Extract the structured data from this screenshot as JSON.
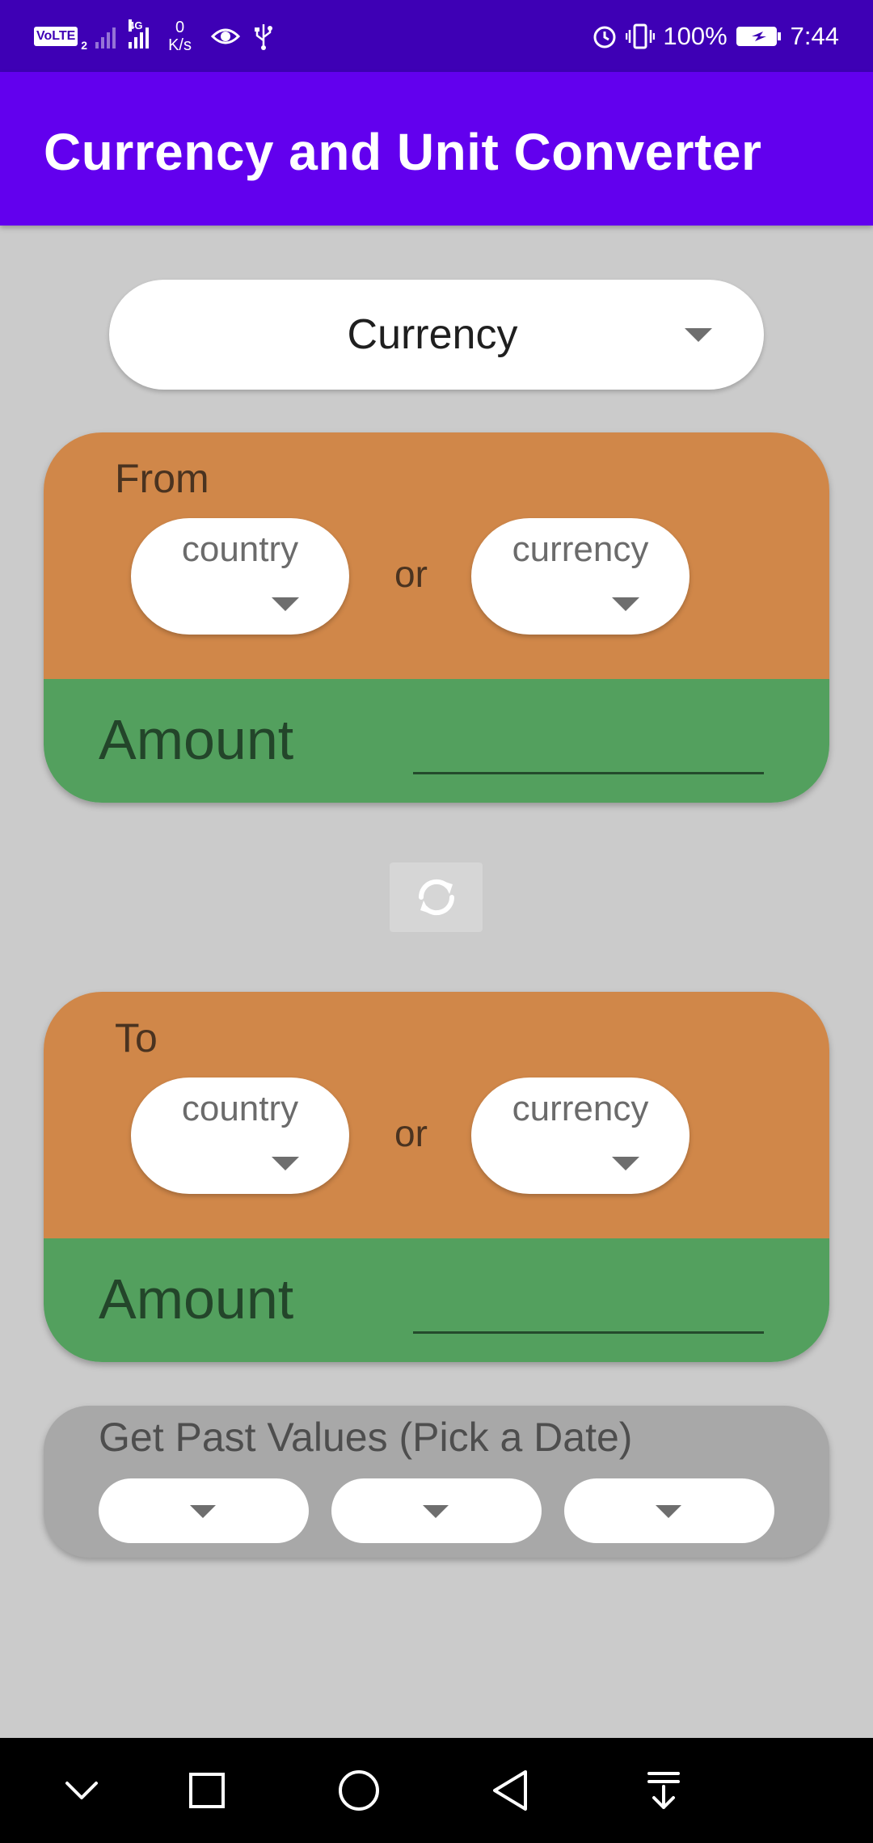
{
  "status_bar": {
    "volte": "VoLTE",
    "sim2": "2",
    "network": "4G",
    "speed_value": "0",
    "speed_unit": "K/s",
    "battery": "100%",
    "time": "7:44"
  },
  "app_bar": {
    "title": "Currency and Unit Converter"
  },
  "mode_spinner": {
    "value": "Currency"
  },
  "from_card": {
    "label": "From",
    "country_hint": "country",
    "or_text": "or",
    "currency_hint": "currency",
    "amount_label": "Amount",
    "amount_value": ""
  },
  "swap": {
    "icon": "swap-icon"
  },
  "to_card": {
    "label": "To",
    "country_hint": "country",
    "or_text": "or",
    "currency_hint": "currency",
    "amount_label": "Amount",
    "amount_value": ""
  },
  "past_values": {
    "label": "Get Past Values (Pick a Date)"
  },
  "colors": {
    "status_bar": "#3e00b5",
    "app_bar": "#6200ee",
    "card_top": "#d08749",
    "card_bottom": "#53a05e",
    "past_panel": "#a8a8a8",
    "background": "#cbcbcb"
  },
  "nav_bar": {
    "icons": [
      "chevron-down-icon",
      "recents-icon",
      "home-icon",
      "back-icon",
      "notification-pull-icon"
    ]
  }
}
